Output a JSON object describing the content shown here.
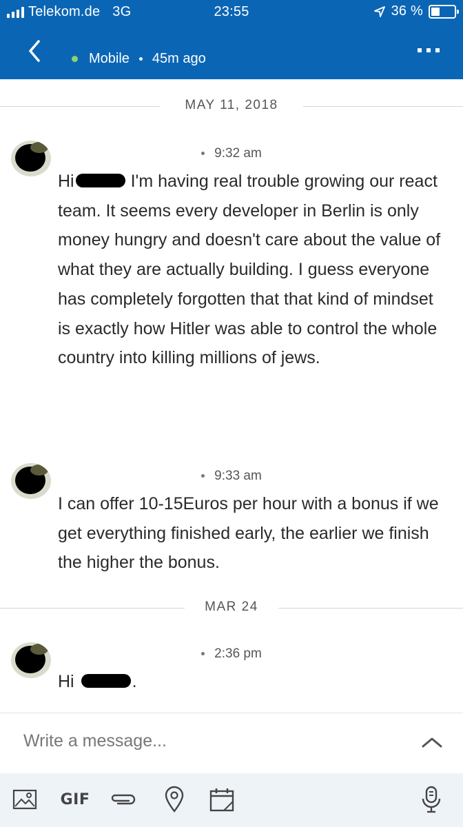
{
  "status_bar": {
    "carrier": "Telekom.de",
    "network": "3G",
    "time": "23:55",
    "battery": "36 %"
  },
  "header": {
    "presence_text": "Mobile",
    "last_seen": "45m ago",
    "presence_color": "#8bd36a",
    "bar_color": "#0a66b5"
  },
  "conversation": {
    "date_1": "MAY 11, 2018",
    "date_2": "MAR 24",
    "messages": [
      {
        "time": "9:32 am",
        "greeting": "Hi",
        "text": "I'm having real trouble growing our react team. It seems every developer in Berlin is only money hungry and doesn't care about the value of what they are actually building. I guess everyone has completely forgotten that that kind of mindset is exactly how Hitler was able to control the whole country into killing millions of jews."
      },
      {
        "time": "9:33 am",
        "text": "I can offer 10-15Euros per hour with a bonus if we get everything finished early, the earlier we finish the higher the bonus."
      },
      {
        "time": "2:36 pm",
        "greeting": "Hi",
        "suffix": "."
      }
    ]
  },
  "compose": {
    "placeholder": "Write a message..."
  },
  "toolbar": {
    "gif_label": "GIF",
    "icons": [
      "image-icon",
      "gif-button",
      "attachment-icon",
      "location-icon",
      "calendar-icon",
      "microphone-icon"
    ]
  }
}
